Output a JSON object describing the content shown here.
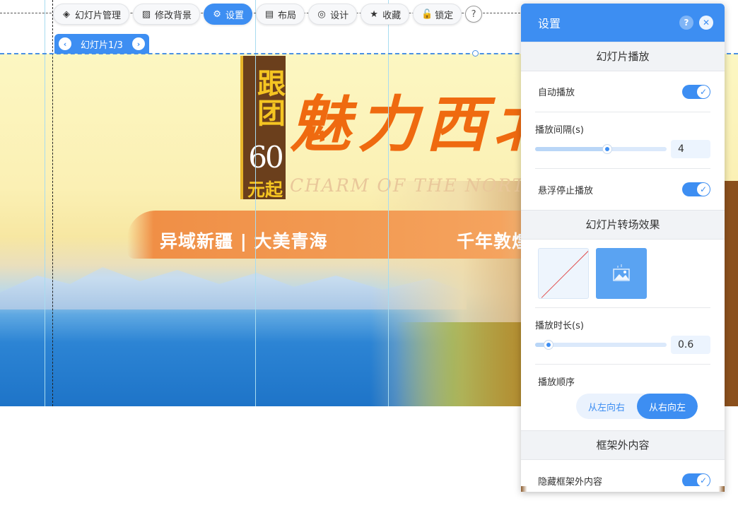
{
  "toolbar": {
    "items": [
      {
        "label": "幻灯片管理",
        "icon": "layers-icon"
      },
      {
        "label": "修改背景",
        "icon": "image-icon"
      },
      {
        "label": "设置",
        "icon": "gear-icon"
      },
      {
        "label": "布局",
        "icon": "layout-icon"
      },
      {
        "label": "设计",
        "icon": "design-icon"
      },
      {
        "label": "收藏",
        "icon": "star-icon"
      },
      {
        "label": "锁定",
        "icon": "lock-icon"
      }
    ],
    "help": "?"
  },
  "pager": {
    "label": "幻灯片1/3"
  },
  "banner": {
    "tag_top": "跟团",
    "tag_number": "60",
    "tag_bottom": "元起",
    "calligraphy": "魅力西北",
    "english": "CHARM OF THE NORTHWEST",
    "slogan_left": "异域新疆 | 大美青海",
    "slogan_right": "千年敦煌"
  },
  "panel": {
    "title": "设置",
    "help": "?",
    "close": "✕",
    "section_play": "幻灯片播放",
    "autoplay_label": "自动播放",
    "autoplay_on": true,
    "interval_label": "播放间隔(s)",
    "interval_value": "4",
    "interval_fraction": 0.55,
    "hover_stop_label": "悬浮停止播放",
    "hover_stop_on": true,
    "section_transition": "幻灯片转场效果",
    "duration_label": "播放时长(s)",
    "duration_value": "0.6",
    "duration_fraction": 0.1,
    "order_label": "播放顺序",
    "order_left_to_right": "从左向右",
    "order_right_to_left": "从右向左",
    "order_selected": "从右向左",
    "section_frame": "框架外内容",
    "hide_outside_label": "隐藏框架外内容",
    "hide_outside_on": true
  },
  "colors": {
    "accent": "#3d8ef2",
    "brand_orange": "#ef6a10",
    "tag_brown": "#6b3f1c",
    "tag_yellow": "#f5c522"
  }
}
